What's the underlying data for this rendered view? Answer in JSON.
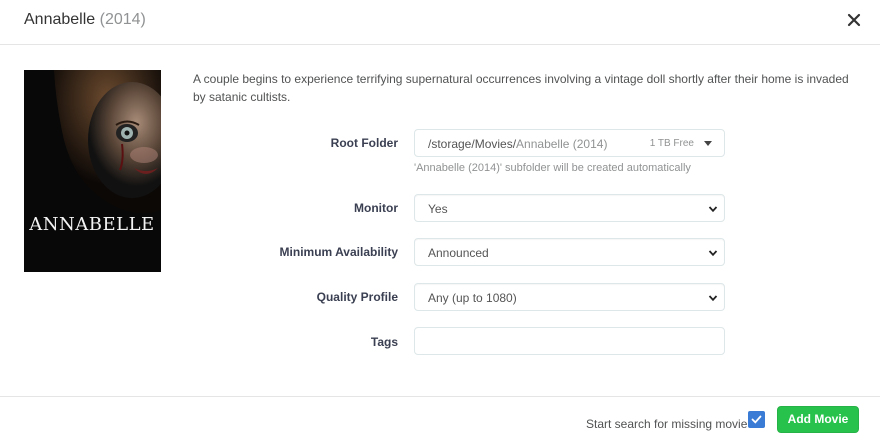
{
  "header": {
    "title": "Annabelle",
    "year": "(2014)",
    "close_icon": "close-icon"
  },
  "poster": {
    "title_text": "ANNABELLE"
  },
  "overview": "A couple begins to experience terrifying supernatural occurrences involving a vintage doll shortly after their home is invaded by satanic cultists.",
  "form": {
    "root_folder": {
      "label": "Root Folder",
      "path": "/storage/Movies/",
      "subfolder": "Annabelle (2014)",
      "free_space": "1 TB Free",
      "help": "'Annabelle (2014)' subfolder will be created automatically"
    },
    "monitor": {
      "label": "Monitor",
      "value": "Yes"
    },
    "minimum_availability": {
      "label": "Minimum Availability",
      "value": "Announced"
    },
    "quality_profile": {
      "label": "Quality Profile",
      "value": "Any (up to 1080)"
    },
    "tags": {
      "label": "Tags",
      "value": ""
    }
  },
  "footer": {
    "search_label": "Start search for missing movie",
    "search_checked": true,
    "add_button": "Add Movie"
  },
  "colors": {
    "accent_green": "#27c24c",
    "checkbox_blue": "#3a7bd5"
  }
}
